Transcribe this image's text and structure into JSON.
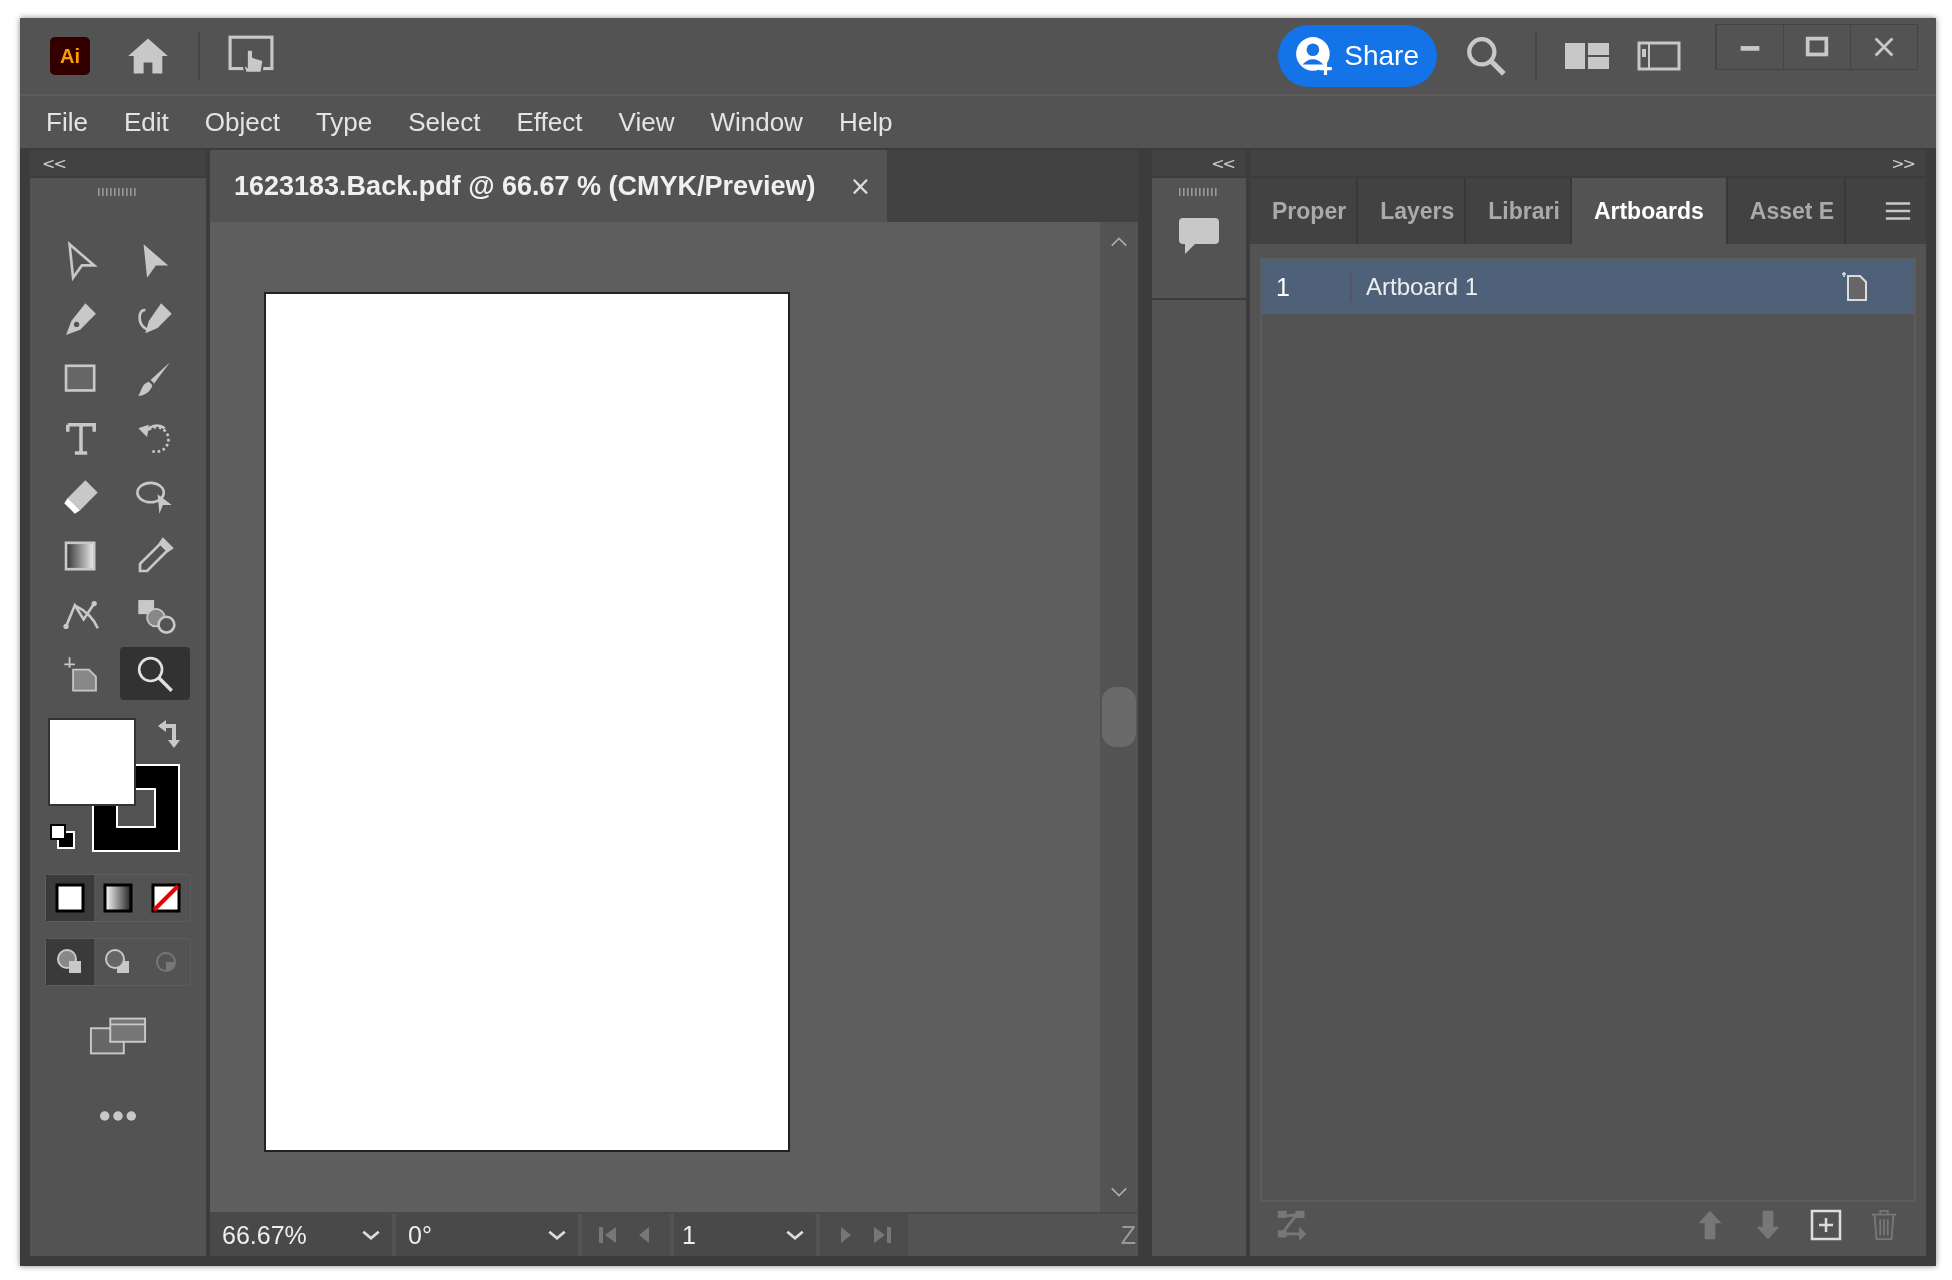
{
  "app_logo": "Ai",
  "share_button": "Share",
  "menu": [
    "File",
    "Edit",
    "Object",
    "Type",
    "Select",
    "Effect",
    "View",
    "Window",
    "Help"
  ],
  "tools_panel": {
    "collapse": "<<"
  },
  "tools": [
    {
      "kind": "selection",
      "selected": false
    },
    {
      "kind": "direct-selection",
      "selected": false
    },
    {
      "kind": "pen",
      "selected": false
    },
    {
      "kind": "curvature",
      "selected": false
    },
    {
      "kind": "rectangle",
      "selected": false
    },
    {
      "kind": "brush",
      "selected": false
    },
    {
      "kind": "type",
      "selected": false
    },
    {
      "kind": "rotate",
      "selected": false
    },
    {
      "kind": "eraser",
      "selected": false
    },
    {
      "kind": "lasso-select",
      "selected": false
    },
    {
      "kind": "gradient",
      "selected": false
    },
    {
      "kind": "eyedropper",
      "selected": false
    },
    {
      "kind": "puppet",
      "selected": false
    },
    {
      "kind": "shape-builder",
      "selected": false
    },
    {
      "kind": "artboard",
      "selected": false
    },
    {
      "kind": "zoom",
      "selected": true
    }
  ],
  "color_modes": [
    {
      "kind": "color",
      "selected": true
    },
    {
      "kind": "gradient",
      "selected": false
    },
    {
      "kind": "none",
      "selected": false
    }
  ],
  "draw_modes": [
    {
      "kind": "normal",
      "selected": true
    },
    {
      "kind": "behind",
      "selected": false
    },
    {
      "kind": "inside",
      "selected": false
    }
  ],
  "document_tab": {
    "title": "1623183.Back.pdf @ 66.67 % (CMYK/Preview)",
    "close": "×"
  },
  "status_bar": {
    "zoom": "66.67%",
    "rotation": "0°",
    "artboard": "1",
    "cut_label": "Z"
  },
  "middle_panel": {
    "collapse": "<<"
  },
  "right_panel": {
    "collapse": ">>",
    "tabs": [
      {
        "label": "Proper",
        "selected": false
      },
      {
        "label": "Layers",
        "selected": false
      },
      {
        "label": "Librari",
        "selected": false
      },
      {
        "label": "Artboards",
        "selected": true
      },
      {
        "label": "Asset E",
        "selected": false
      }
    ],
    "artboards": [
      {
        "number": "1",
        "name": "Artboard 1",
        "selected": true
      }
    ]
  }
}
